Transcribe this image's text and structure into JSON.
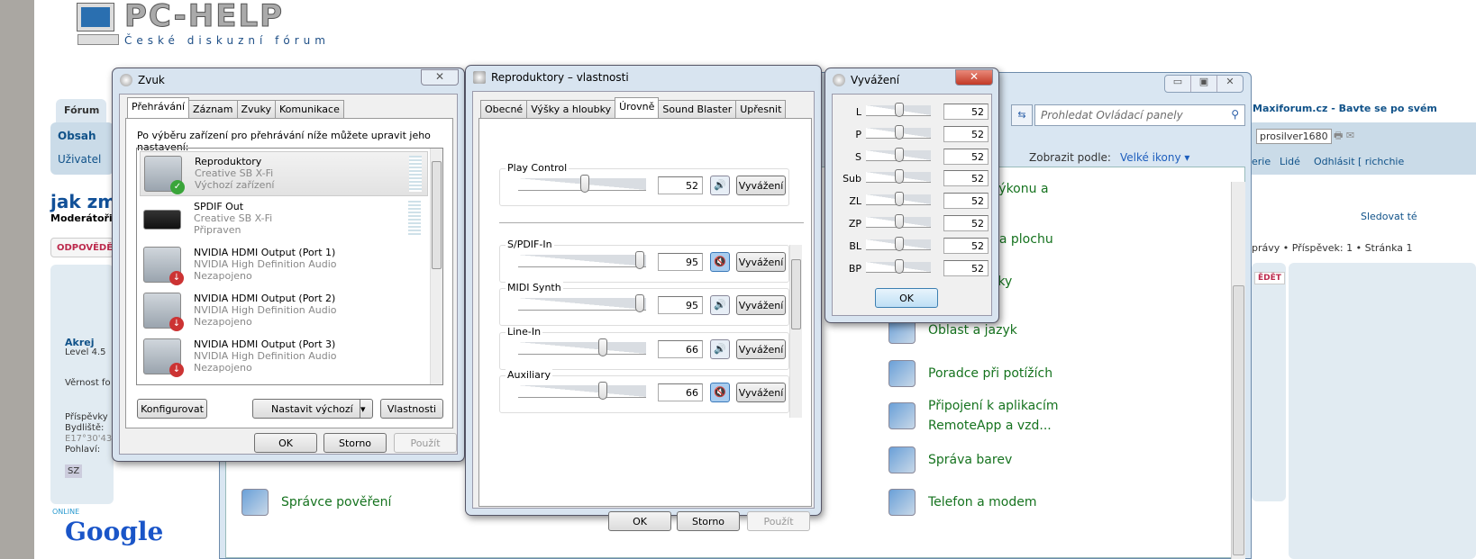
{
  "forum": {
    "logo_text": "PC-HELP",
    "logo_subtitle": "České diskuzní fórum",
    "tab": "Fórum",
    "nav": [
      "Obsah",
      "Uživatel"
    ],
    "topic_title": "jak změ",
    "moderators": "Moderátoři",
    "reply": "ODPOVĚDĚT",
    "user": {
      "name": "Akrej",
      "level": "Level 4.5",
      "loyalty": "Věrnost fo",
      "posts": "Příspěvky",
      "location": "Bydliště:",
      "coords": "E17°30'43",
      "gender": "Pohlaví:",
      "pm": "SZ"
    },
    "online": "ONLINE",
    "google": "Google",
    "right": {
      "site": "Maxiforum.cz - Bavte se po svém",
      "style_select": "prosilver1680",
      "links": [
        "erie",
        "Lidé",
        "Odhlásit [ richchie"
      ],
      "watch": "Sledovat té",
      "pagination": "právy • Příspěvek: 1 • Stránka 1",
      "reply_short": "ĚDĚT"
    }
  },
  "control_panel": {
    "search_placeholder": "Prohledat Ovládací panely",
    "view_by_label": "Zobrazit podle:",
    "view_by_value": "Velké ikony",
    "window_buttons": [
      "minimize",
      "maximize",
      "close"
    ],
    "items": [
      {
        "label": "výkonu a"
      },
      {
        "label": "na plochu"
      },
      {
        "label": "žky"
      },
      {
        "label": "Oblast a jazyk"
      },
      {
        "label": "Poradce při potížích"
      },
      {
        "label": "Připojení k aplikacím RemoteApp a vzd..."
      },
      {
        "label": "Správa barev"
      },
      {
        "label": "Telefon a modem"
      },
      {
        "label": "Správce pověření"
      }
    ]
  },
  "sound_dialog": {
    "title": "Zvuk",
    "tabs": [
      "Přehrávání",
      "Záznam",
      "Zvuky",
      "Komunikace"
    ],
    "active_tab": 0,
    "instruction": "Po výběru zařízení pro přehrávání níže můžete upravit jeho nastavení:",
    "devices": [
      {
        "name": "Reproduktory",
        "driver": "Creative SB X-Fi",
        "status": "Výchozí zařízení",
        "selected": true,
        "badge": "check"
      },
      {
        "name": "SPDIF Out",
        "driver": "Creative SB X-Fi",
        "status": "Připraven",
        "selected": false,
        "badge": ""
      },
      {
        "name": "NVIDIA HDMI Output (Port 1)",
        "driver": "NVIDIA High Definition Audio",
        "status": "Nezapojeno",
        "selected": false,
        "badge": "unplugged"
      },
      {
        "name": "NVIDIA HDMI Output (Port 2)",
        "driver": "NVIDIA High Definition Audio",
        "status": "Nezapojeno",
        "selected": false,
        "badge": "unplugged"
      },
      {
        "name": "NVIDIA HDMI Output (Port 3)",
        "driver": "NVIDIA High Definition Audio",
        "status": "Nezapojeno",
        "selected": false,
        "badge": "unplugged"
      }
    ],
    "buttons": {
      "configure": "Konfigurovat",
      "set_default": "Nastavit výchozí",
      "properties": "Vlastnosti",
      "ok": "OK",
      "cancel": "Storno",
      "apply": "Použít"
    }
  },
  "properties_dialog": {
    "title": "Reproduktory – vlastnosti",
    "tabs": [
      "Obecné",
      "Výšky a hloubky",
      "Úrovně",
      "Sound Blaster",
      "Upřesnit"
    ],
    "active_tab": 2,
    "balance_label": "Vyvážení",
    "levels": [
      {
        "name": "Play Control",
        "value": 52,
        "muted": false
      },
      {
        "name": "S/PDIF-In",
        "value": 95,
        "muted": true
      },
      {
        "name": "MIDI Synth",
        "value": 95,
        "muted": false
      },
      {
        "name": "Line-In",
        "value": 66,
        "muted": false
      },
      {
        "name": "Auxiliary",
        "value": 66,
        "muted": true
      }
    ],
    "buttons": {
      "ok": "OK",
      "cancel": "Storno",
      "apply": "Použít"
    }
  },
  "balance_dialog": {
    "title": "Vyvážení",
    "channels": [
      {
        "label": "L",
        "value": 52
      },
      {
        "label": "P",
        "value": 52
      },
      {
        "label": "S",
        "value": 52
      },
      {
        "label": "Sub",
        "value": 52
      },
      {
        "label": "ZL",
        "value": 52
      },
      {
        "label": "ZP",
        "value": 52
      },
      {
        "label": "BL",
        "value": 52
      },
      {
        "label": "BP",
        "value": 52
      }
    ],
    "ok": "OK"
  }
}
